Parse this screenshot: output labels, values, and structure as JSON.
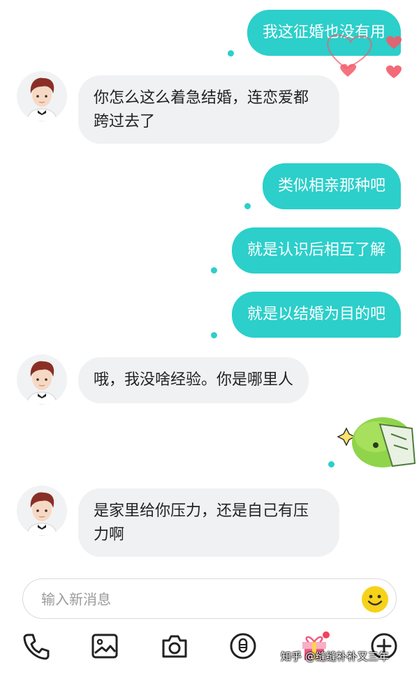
{
  "messages": [
    {
      "side": "out",
      "text": "我这征婚也没有用"
    },
    {
      "side": "in",
      "text_line1": "你怎么这么着急结婚，连恋爱都",
      "text_line2": "跨过去了"
    },
    {
      "side": "out",
      "text": "类似相亲那种吧"
    },
    {
      "side": "out",
      "text": "就是认识后相互了解"
    },
    {
      "side": "out",
      "text": "就是以结婚为目的吧"
    },
    {
      "side": "in",
      "text": "哦，我没啥经验。你是哪里人"
    },
    {
      "side": "out",
      "sticker": "green-blob-sticker"
    },
    {
      "side": "in",
      "text_line1": "是家里给你压力，还是自己有压",
      "text_line2": "力啊"
    }
  ],
  "composer": {
    "placeholder": "输入新消息",
    "emoji_icon": "smiley-icon"
  },
  "toolbar": {
    "icons": [
      "phone-icon",
      "image-icon",
      "camera-icon",
      "voice-icon",
      "gift-icon",
      "add-icon"
    ]
  },
  "watermark": "知乎 @缝缝补补又三年",
  "colors": {
    "bubble_out": "#2ccfca",
    "bubble_in": "#f0f1f3",
    "heart": "#f25a69",
    "emoji": "#f7d21a"
  }
}
